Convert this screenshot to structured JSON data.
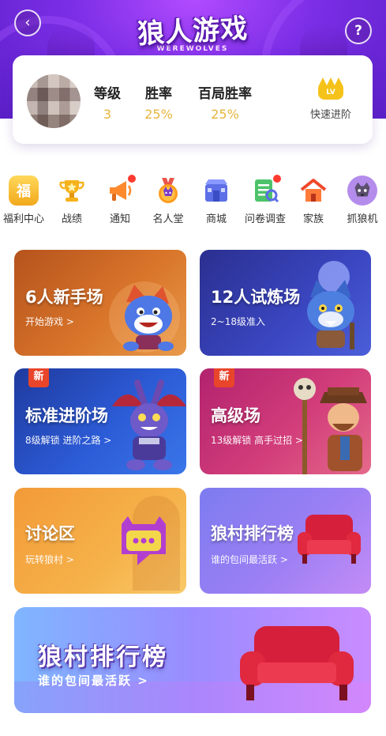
{
  "header": {
    "logo_title": "狼人游戏",
    "logo_subtitle": "WEREWOLVES",
    "back_icon": "back-arrow-icon",
    "help_icon": "question-mark-icon"
  },
  "profile": {
    "stats": [
      {
        "label": "等级",
        "value": "3"
      },
      {
        "label": "胜率",
        "value": "25%"
      },
      {
        "label": "百局胜率",
        "value": "25%"
      }
    ],
    "quick_upgrade": {
      "label": "快速进阶",
      "badge": "LV"
    }
  },
  "shortcuts": [
    {
      "label": "福利中心",
      "icon": "welfare-icon",
      "glyph": "福",
      "color": "#f2b531"
    },
    {
      "label": "战绩",
      "icon": "trophy-icon",
      "glyph": "🏆",
      "color": "#f3a41d"
    },
    {
      "label": "通知",
      "icon": "megaphone-icon",
      "glyph": "📣",
      "color": "#ff7a2e",
      "dot": true
    },
    {
      "label": "名人堂",
      "icon": "wolf-medal-icon",
      "glyph": "🐺",
      "color": "#ff8a1f"
    },
    {
      "label": "商城",
      "icon": "shop-icon",
      "glyph": "🛍",
      "color": "#6a7cf0"
    },
    {
      "label": "问卷调查",
      "icon": "survey-icon",
      "glyph": "📋",
      "color": "#4ec46a",
      "dot": true
    },
    {
      "label": "家族",
      "icon": "house-icon",
      "glyph": "🏠",
      "color": "#f0572e"
    },
    {
      "label": "抓狼机",
      "icon": "claw-machine-icon",
      "glyph": "🐾",
      "color": "#a77ae6"
    }
  ],
  "rooms": [
    {
      "title": "6人新手场",
      "subtitle": "开始游戏 >",
      "new": false
    },
    {
      "title": "12人试炼场",
      "subtitle": "2~18级准入",
      "new": false
    },
    {
      "title": "标准进阶场",
      "subtitle": "8级解锁 进阶之路 >",
      "new": true
    },
    {
      "title": "高级场",
      "subtitle": "13级解锁 高手过招 >",
      "new": true
    },
    {
      "title": "讨论区",
      "subtitle": "玩转狼村 >",
      "new": false
    },
    {
      "title": "狼村排行榜",
      "subtitle": "谁的包间最活跃 >",
      "new": false
    }
  ],
  "new_badge": "新",
  "banner": {
    "title": "狼村排行榜",
    "subtitle": "谁的包间最活跃 >"
  },
  "colors": {
    "accent_gold": "#e8b43c",
    "header_purple": "#7b2ee6"
  }
}
